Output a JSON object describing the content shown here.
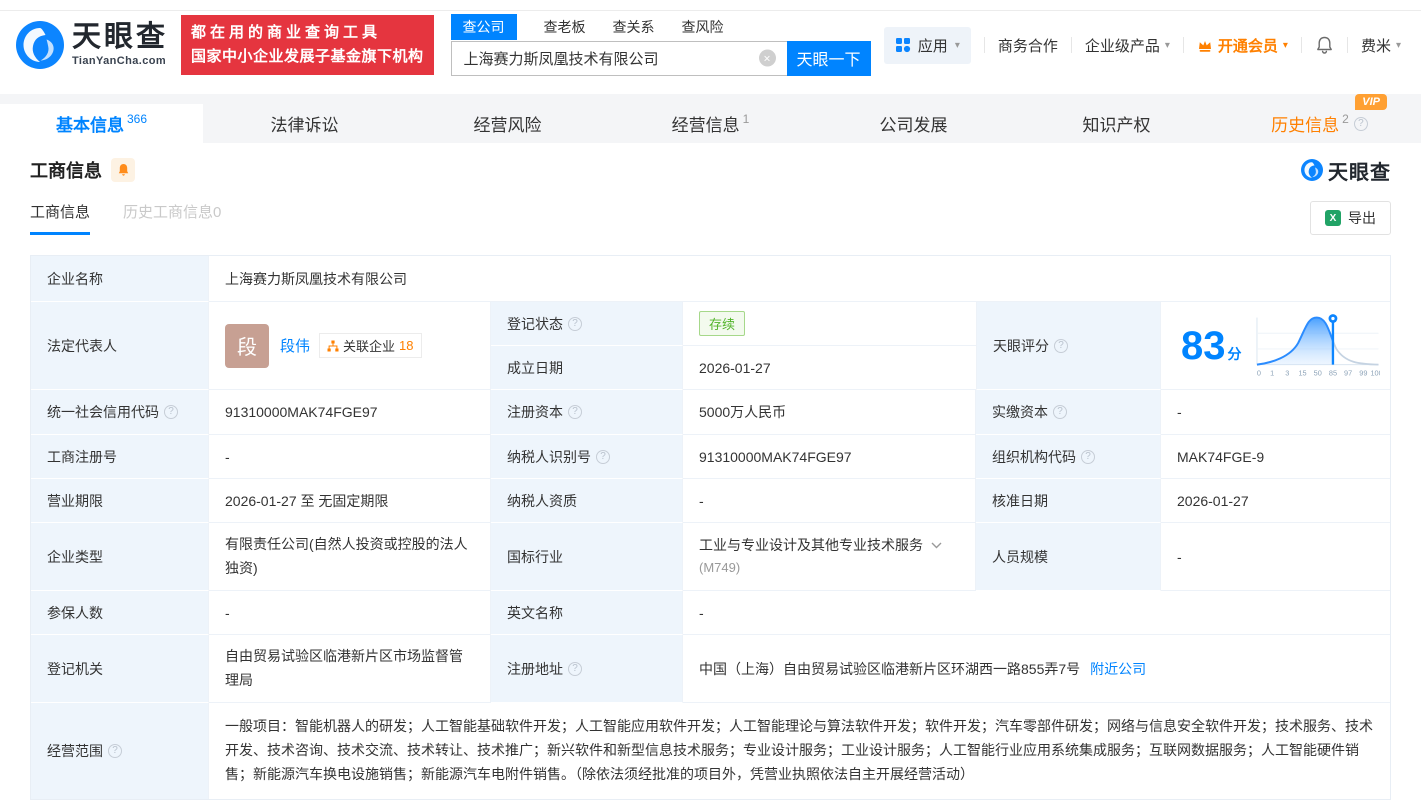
{
  "header": {
    "logo_text": "天眼查",
    "logo_domain": "TianYanCha.com",
    "slogan_line1": "都在用的商业查询工具",
    "slogan_line2": "国家中小企业发展子基金旗下机构",
    "search_tabs": [
      {
        "label": "查公司"
      },
      {
        "label": "查老板"
      },
      {
        "label": "查关系"
      },
      {
        "label": "查风险"
      }
    ],
    "search_value": "上海赛力斯凤凰技术有限公司",
    "search_button": "天眼一下",
    "nav": {
      "apps": "应用",
      "cooperation": "商务合作",
      "enterprise": "企业级产品",
      "vip": "开通会员",
      "user": "费米"
    }
  },
  "tabs": [
    {
      "label": "基本信息",
      "count": "366"
    },
    {
      "label": "法律诉讼",
      "count": ""
    },
    {
      "label": "经营风险",
      "count": ""
    },
    {
      "label": "经营信息",
      "count": "1"
    },
    {
      "label": "公司发展",
      "count": ""
    },
    {
      "label": "知识产权",
      "count": ""
    },
    {
      "label": "历史信息",
      "count": "2",
      "vip": "VIP"
    }
  ],
  "section": {
    "title": "工商信息",
    "watermark": "天眼查",
    "subtab_active": "工商信息",
    "subtab_history": "历史工商信息0",
    "export_label": "导出"
  },
  "fields": {
    "company_name": {
      "label": "企业名称",
      "value": "上海赛力斯凤凰技术有限公司"
    },
    "legal_rep": {
      "label": "法定代表人",
      "avatar": "段",
      "name": "段伟",
      "badge_label": "关联企业",
      "badge_count": "18"
    },
    "reg_status": {
      "label": "登记状态",
      "value": "存续"
    },
    "establish_date": {
      "label": "成立日期",
      "value": "2026-01-27"
    },
    "score": {
      "label": "天眼评分",
      "value": "83",
      "unit": "分"
    },
    "credit_code": {
      "label": "统一社会信用代码",
      "value": "91310000MAK74FGE97"
    },
    "reg_capital": {
      "label": "注册资本",
      "value": "5000万人民币"
    },
    "paid_capital": {
      "label": "实缴资本",
      "value": "-"
    },
    "reg_number": {
      "label": "工商注册号",
      "value": "-"
    },
    "taxpayer_id": {
      "label": "纳税人识别号",
      "value": "91310000MAK74FGE97"
    },
    "org_code": {
      "label": "组织机构代码",
      "value": "MAK74FGE-9"
    },
    "business_term": {
      "label": "营业期限",
      "value": "2026-01-27 至 无固定期限"
    },
    "taxpayer_quality": {
      "label": "纳税人资质",
      "value": "-"
    },
    "approval_date": {
      "label": "核准日期",
      "value": "2026-01-27"
    },
    "company_type": {
      "label": "企业类型",
      "value": "有限责任公司(自然人投资或控股的法人独资)"
    },
    "industry": {
      "label": "国标行业",
      "value": "工业与专业设计及其他专业技术服务",
      "code": "(M749)"
    },
    "staff_size": {
      "label": "人员规模",
      "value": "-"
    },
    "insured_count": {
      "label": "参保人数",
      "value": "-"
    },
    "english_name": {
      "label": "英文名称",
      "value": "-"
    },
    "reg_authority": {
      "label": "登记机关",
      "value": "自由贸易试验区临港新片区市场监督管理局"
    },
    "reg_address": {
      "label": "注册地址",
      "value": "中国（上海）自由贸易试验区临港新片区环湖西一路855弄7号",
      "nearby_link": "附近公司"
    },
    "business_scope": {
      "label": "经营范围",
      "value": "一般项目：智能机器人的研发；人工智能基础软件开发；人工智能应用软件开发；人工智能理论与算法软件开发；软件开发；汽车零部件研发；网络与信息安全软件开发；技术服务、技术开发、技术咨询、技术交流、技术转让、技术推广；新兴软件和新型信息技术服务；专业设计服务；工业设计服务；人工智能行业应用系统集成服务；互联网数据服务；人工智能硬件销售；新能源汽车换电设施销售；新能源汽车电附件销售。（除依法须经批准的项目外，凭营业执照依法自主开展经营活动）"
    }
  },
  "score_chart": {
    "type": "area",
    "ticks": [
      "0",
      "1",
      "3",
      "15",
      "50",
      "85",
      "97",
      "99",
      "100"
    ],
    "marker_tick": "85",
    "score": 83
  },
  "colors": {
    "primary_blue": "#0084ff",
    "brand_red": "#e5353f",
    "vip_orange": "#ff8000",
    "status_green": "#52b42a"
  },
  "icons": {
    "help": "?",
    "caret_down": "▾",
    "clear": "×",
    "excel": "X"
  }
}
